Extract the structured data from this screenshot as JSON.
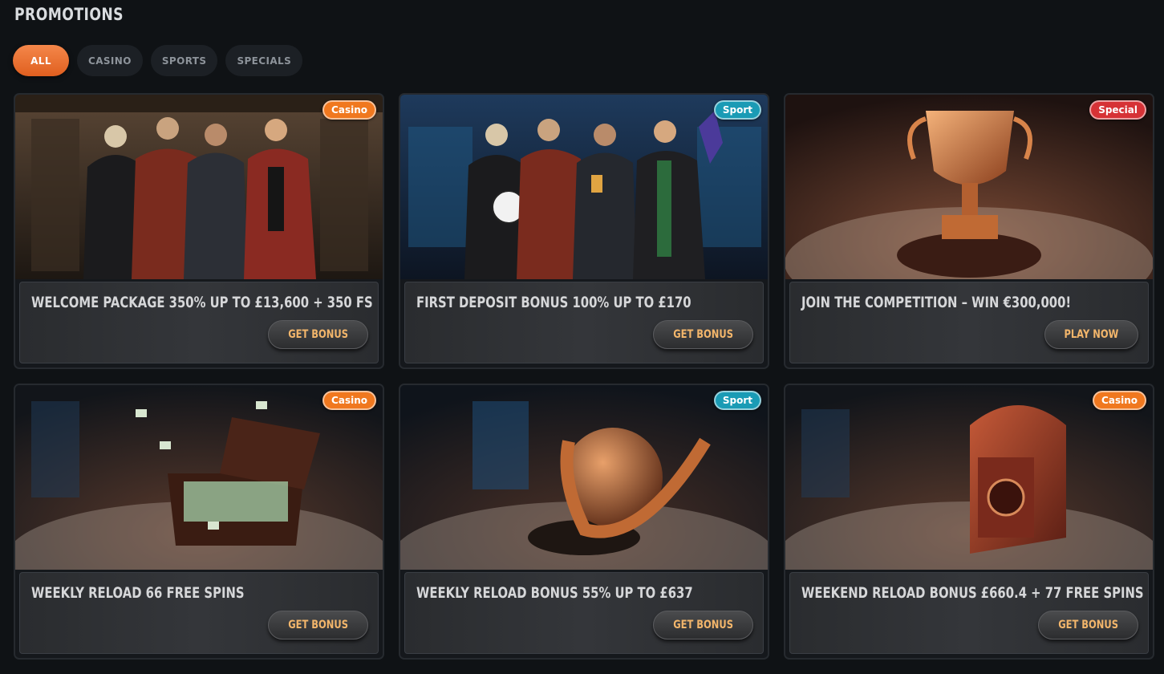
{
  "page": {
    "title": "PROMOTIONS"
  },
  "tabs": [
    {
      "label": "ALL",
      "active": true
    },
    {
      "label": "CASINO",
      "active": false
    },
    {
      "label": "SPORTS",
      "active": false
    },
    {
      "label": "SPECIALS",
      "active": false
    }
  ],
  "colors": {
    "casino": "#f0781f",
    "sport": "#1a9bb5",
    "special": "#d63236",
    "accent": "#ee7433",
    "cta_text": "#f3b66b"
  },
  "promotions": [
    {
      "badge": "Casino",
      "badge_type": "casino",
      "title": "WELCOME PACKAGE 350% UP TO £13,600 + 350 FS",
      "cta": "GET BONUS",
      "art": "four-characters-casino"
    },
    {
      "badge": "Sport",
      "badge_type": "sport",
      "title": "FIRST DEPOSIT BONUS 100% UP TO £170",
      "cta": "GET BONUS",
      "art": "four-characters-sport"
    },
    {
      "badge": "Special",
      "badge_type": "special",
      "title": "JOIN THE COMPETITION – WIN €300,000!",
      "cta": "PLAY NOW",
      "art": "trophy-cup"
    },
    {
      "badge": "Casino",
      "badge_type": "casino",
      "title": "WEEKLY RELOAD 66 FREE SPINS",
      "cta": "GET BONUS",
      "art": "money-suitcase"
    },
    {
      "badge": "Sport",
      "badge_type": "sport",
      "title": "WEEKLY RELOAD BONUS 55% UP TO £637",
      "cta": "GET BONUS",
      "art": "football-arrow"
    },
    {
      "badge": "Casino",
      "badge_type": "casino",
      "title": "WEEKEND RELOAD BONUS £660.4 + 77 FREE SPINS",
      "cta": "GET BONUS",
      "art": "slot-safe"
    }
  ]
}
